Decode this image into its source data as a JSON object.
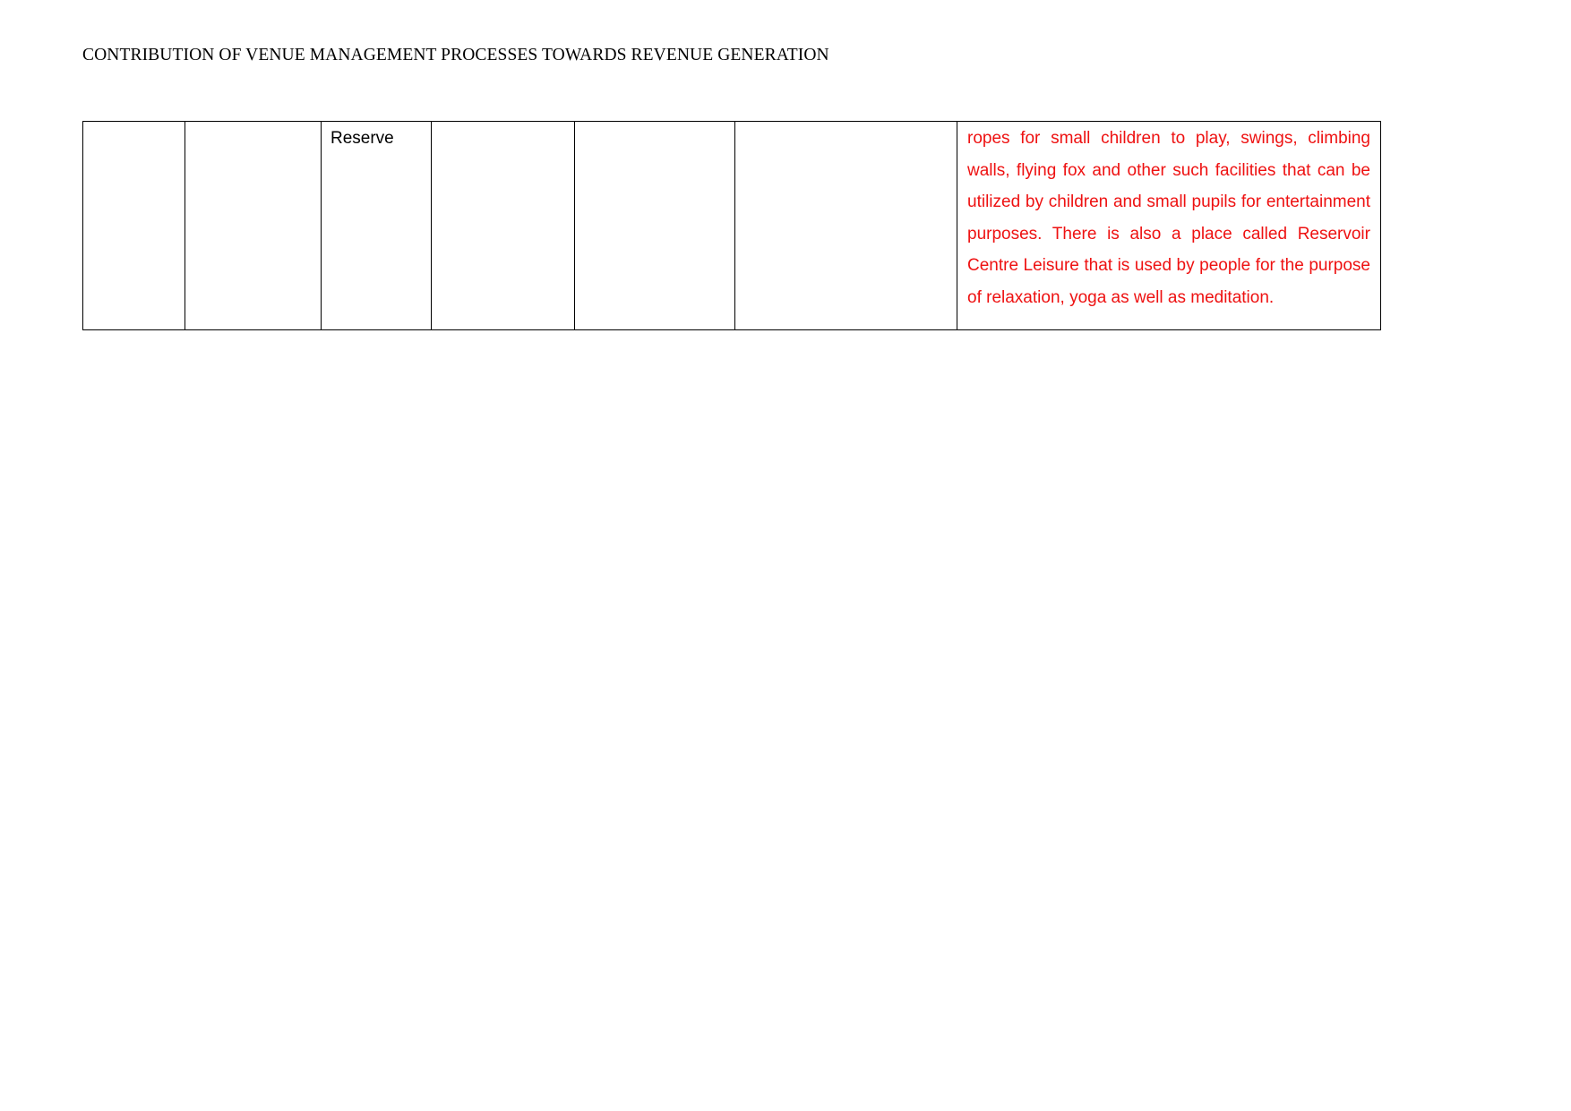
{
  "document": {
    "header_title": "CONTRIBUTION OF VENUE MANAGEMENT PROCESSES TOWARDS REVENUE GENERATION",
    "text_colors": {
      "body": "#000000",
      "highlight_red": "#ee1111"
    }
  },
  "table": {
    "columns": 7,
    "rows": [
      {
        "cells": [
          "",
          "",
          "Reserve",
          "",
          "",
          "",
          "ropes for small children to play, swings, climbing walls, flying fox and other such facilities that can be utilized by children and small pupils for entertainment purposes. There is also a place called Reservoir Centre Leisure that is used by people for the purpose of relaxation, yoga as well as meditation."
        ]
      }
    ]
  }
}
